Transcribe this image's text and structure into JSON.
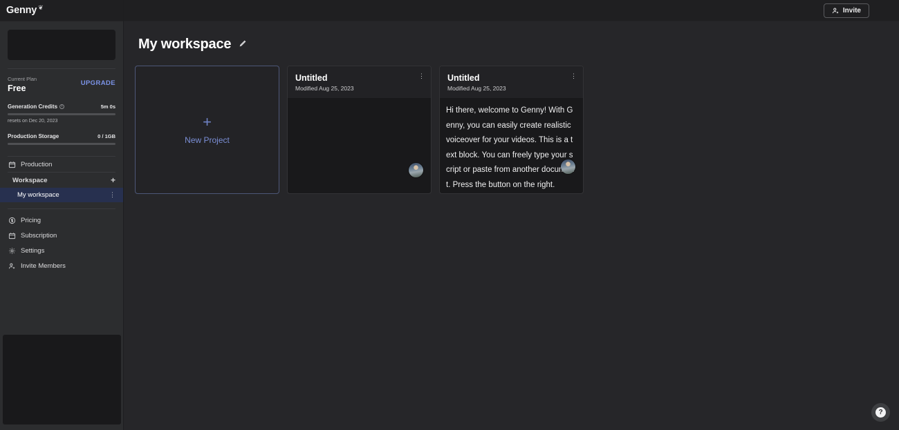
{
  "brand": {
    "name": "Genny",
    "mark": "❦"
  },
  "sidebar": {
    "plan": {
      "label": "Current Plan",
      "name": "Free",
      "upgrade_label": "UPGRADE"
    },
    "meters": [
      {
        "title": "Generation Credits",
        "info_icon": "info-icon",
        "value": "5m 0s",
        "progress_percent": 0,
        "sub": "resets on Dec 20, 2023"
      },
      {
        "title": "Production Storage",
        "value": "0 / 1GB",
        "progress_percent": 0
      }
    ],
    "production": {
      "label": "Production",
      "icon": "calendar-icon"
    },
    "workspace_group": {
      "label": "Workspace",
      "chevron_icon": "chevron-up-icon",
      "add_icon": "plus-icon",
      "items": [
        {
          "label": "My workspace",
          "icon": "folder-icon",
          "menu_icon": "kebab-icon",
          "selected": true
        }
      ]
    },
    "nav": [
      {
        "label": "Pricing",
        "icon": "dollar-circle-icon"
      },
      {
        "label": "Subscription",
        "icon": "calendar-icon"
      },
      {
        "label": "Settings",
        "icon": "gear-icon"
      },
      {
        "label": "Invite Members",
        "icon": "user-plus-icon"
      }
    ]
  },
  "topbar": {
    "invite_label": "Invite",
    "invite_icon": "user-plus-icon"
  },
  "page": {
    "title": "My workspace",
    "edit_icon": "pencil-icon"
  },
  "cards": {
    "new_project": {
      "label": "New Project",
      "plus_icon": "plus-icon"
    },
    "projects": [
      {
        "title": "Untitled",
        "modified": "Modified Aug 25, 2023",
        "menu_icon": "kebab-icon",
        "body_text": "",
        "avatar": "user-avatar"
      },
      {
        "title": "Untitled",
        "modified": "Modified Aug 25, 2023",
        "menu_icon": "kebab-icon",
        "body_text": "Hi there, welcome to Genny! With Genny, you can easily create realistic voiceover for your videos. This is a text block. You can freely type your script or paste from another document. Press the button on the right.",
        "avatar": "user-avatar"
      }
    ]
  },
  "help": {
    "icon": "question-mark-icon",
    "glyph": "?"
  },
  "colors": {
    "app_background": "#262629",
    "sidebar_background": "#2c2d2f",
    "topbar_background": "#1f1f21",
    "accent_blue": "#7b93e8",
    "selected_row": "#27304f",
    "card_background": "#19191b"
  }
}
